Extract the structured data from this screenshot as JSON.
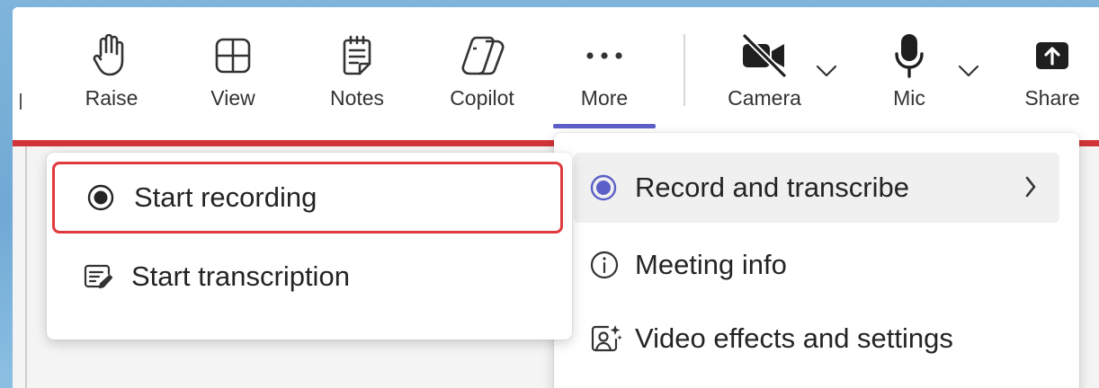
{
  "toolbar": {
    "raise_label": "Raise",
    "view_label": "View",
    "notes_label": "Notes",
    "copilot_label": "Copilot",
    "more_label": "More",
    "camera_label": "Camera",
    "mic_label": "Mic",
    "share_label": "Share"
  },
  "more_menu": {
    "items": [
      {
        "label": "Record and transcribe",
        "icon": "radio-record-icon"
      },
      {
        "label": "Meeting info",
        "icon": "info-icon"
      },
      {
        "label": "Video effects and settings",
        "icon": "video-effects-icon"
      }
    ]
  },
  "record_submenu": {
    "items": [
      {
        "label": "Start recording",
        "icon": "record-icon"
      },
      {
        "label": "Start transcription",
        "icon": "transcription-icon"
      }
    ]
  },
  "colors": {
    "accent": "#5b5fc7",
    "alert_red": "#d13438",
    "focus_outline": "#e0393e"
  }
}
